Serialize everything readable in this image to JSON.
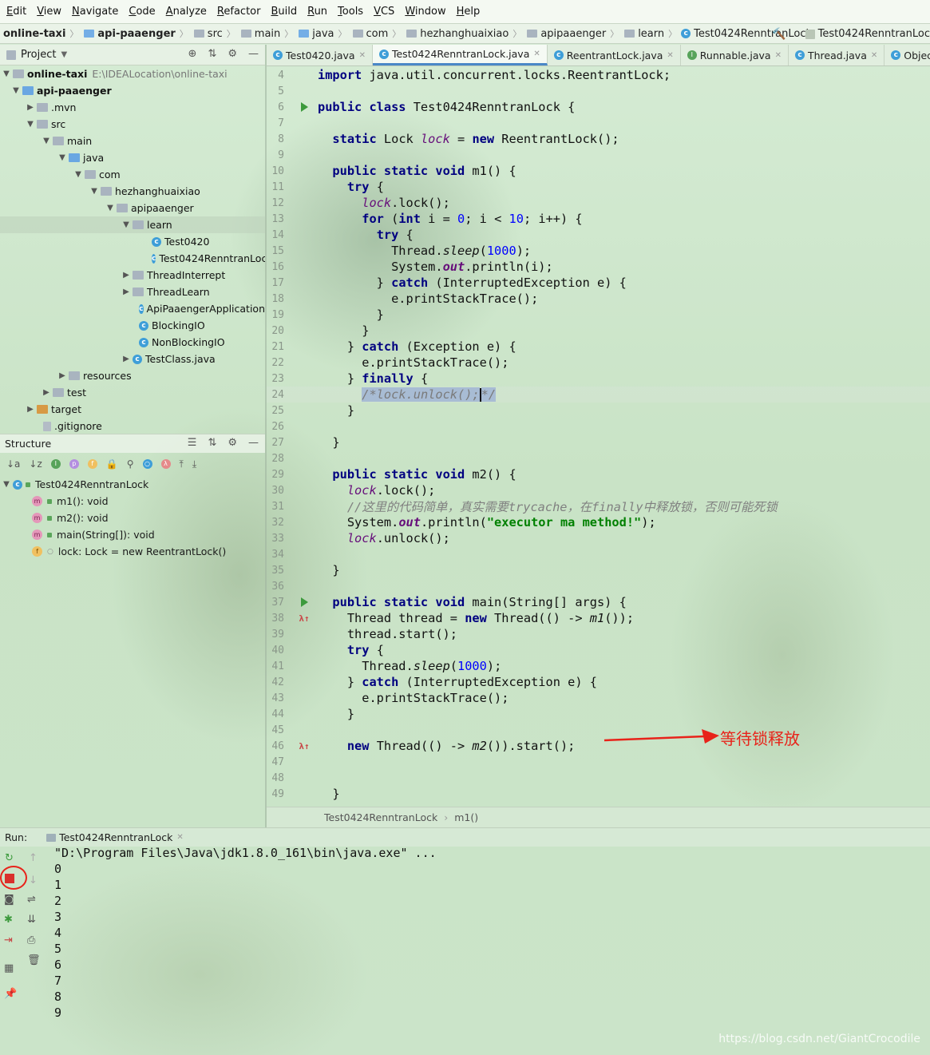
{
  "menu": [
    "Edit",
    "View",
    "Navigate",
    "Code",
    "Analyze",
    "Refactor",
    "Build",
    "Run",
    "Tools",
    "VCS",
    "Window",
    "Help"
  ],
  "breadcrumb": [
    "online-taxi",
    "api-paaenger",
    "src",
    "main",
    "java",
    "com",
    "hezhanghuaixiao",
    "apipaaenger",
    "learn",
    "Test0424RenntranLock"
  ],
  "run_config": "Test0424RenntranLoc",
  "project_panel": {
    "title": "Project",
    "tree": [
      {
        "label": "online-taxi",
        "path": "E:\\IDEALocation\\online-taxi"
      },
      {
        "label": "api-paaenger"
      },
      {
        "label": ".mvn"
      },
      {
        "label": "src"
      },
      {
        "label": "main"
      },
      {
        "label": "java"
      },
      {
        "label": "com"
      },
      {
        "label": "hezhanghuaixiao"
      },
      {
        "label": "apipaaenger"
      },
      {
        "label": "learn"
      },
      {
        "label": "Test0420"
      },
      {
        "label": "Test0424RenntranLoc"
      },
      {
        "label": "ThreadInterrept"
      },
      {
        "label": "ThreadLearn"
      },
      {
        "label": "ApiPaaengerApplication"
      },
      {
        "label": "BlockingIO"
      },
      {
        "label": "NonBlockingIO"
      },
      {
        "label": "TestClass.java"
      },
      {
        "label": "resources"
      },
      {
        "label": "test"
      },
      {
        "label": "target"
      },
      {
        "label": ".gitignore"
      }
    ]
  },
  "structure_panel": {
    "title": "Structure",
    "class_name": "Test0424RenntranLock",
    "members": [
      "m1(): void",
      "m2(): void",
      "main(String[]): void",
      "lock: Lock = new ReentrantLock()"
    ]
  },
  "tabs": [
    "Test0420.java",
    "Test0424RenntranLock.java",
    "ReentrantLock.java",
    "Runnable.java",
    "Thread.java",
    "Object.java"
  ],
  "editor": {
    "line_numbers": [
      "4",
      "5",
      "6",
      "7",
      "8",
      "9",
      "10",
      "11",
      "12",
      "13",
      "14",
      "15",
      "16",
      "17",
      "18",
      "19",
      "20",
      "21",
      "22",
      "23",
      "24",
      "25",
      "26",
      "27",
      "28",
      "29",
      "30",
      "31",
      "32",
      "33",
      "34",
      "35",
      "36",
      "37",
      "38",
      "39",
      "40",
      "41",
      "42",
      "43",
      "44",
      "45",
      "46",
      "47",
      "48",
      "49"
    ],
    "breadcrumb": [
      "Test0424RenntranLock",
      "m1()"
    ],
    "comment_text": "//这里的代码简单，真实需要trycache，在finally中释放锁，否则可能死锁",
    "print_string": "\"executor ma method!\""
  },
  "annotation": "等待锁释放",
  "run_panel": {
    "label": "Run:",
    "tab": "Test0424RenntranLock",
    "console": [
      "\"D:\\Program Files\\Java\\jdk1.8.0_161\\bin\\java.exe\" ...",
      "0",
      "1",
      "2",
      "3",
      "4",
      "5",
      "6",
      "7",
      "8",
      "9"
    ]
  },
  "watermark": "https://blog.csdn.net/GiantCrocodile",
  "colors": {
    "keyword": "#000080",
    "string": "#008000",
    "number": "#0000ff",
    "annotation": "#e8231a"
  }
}
